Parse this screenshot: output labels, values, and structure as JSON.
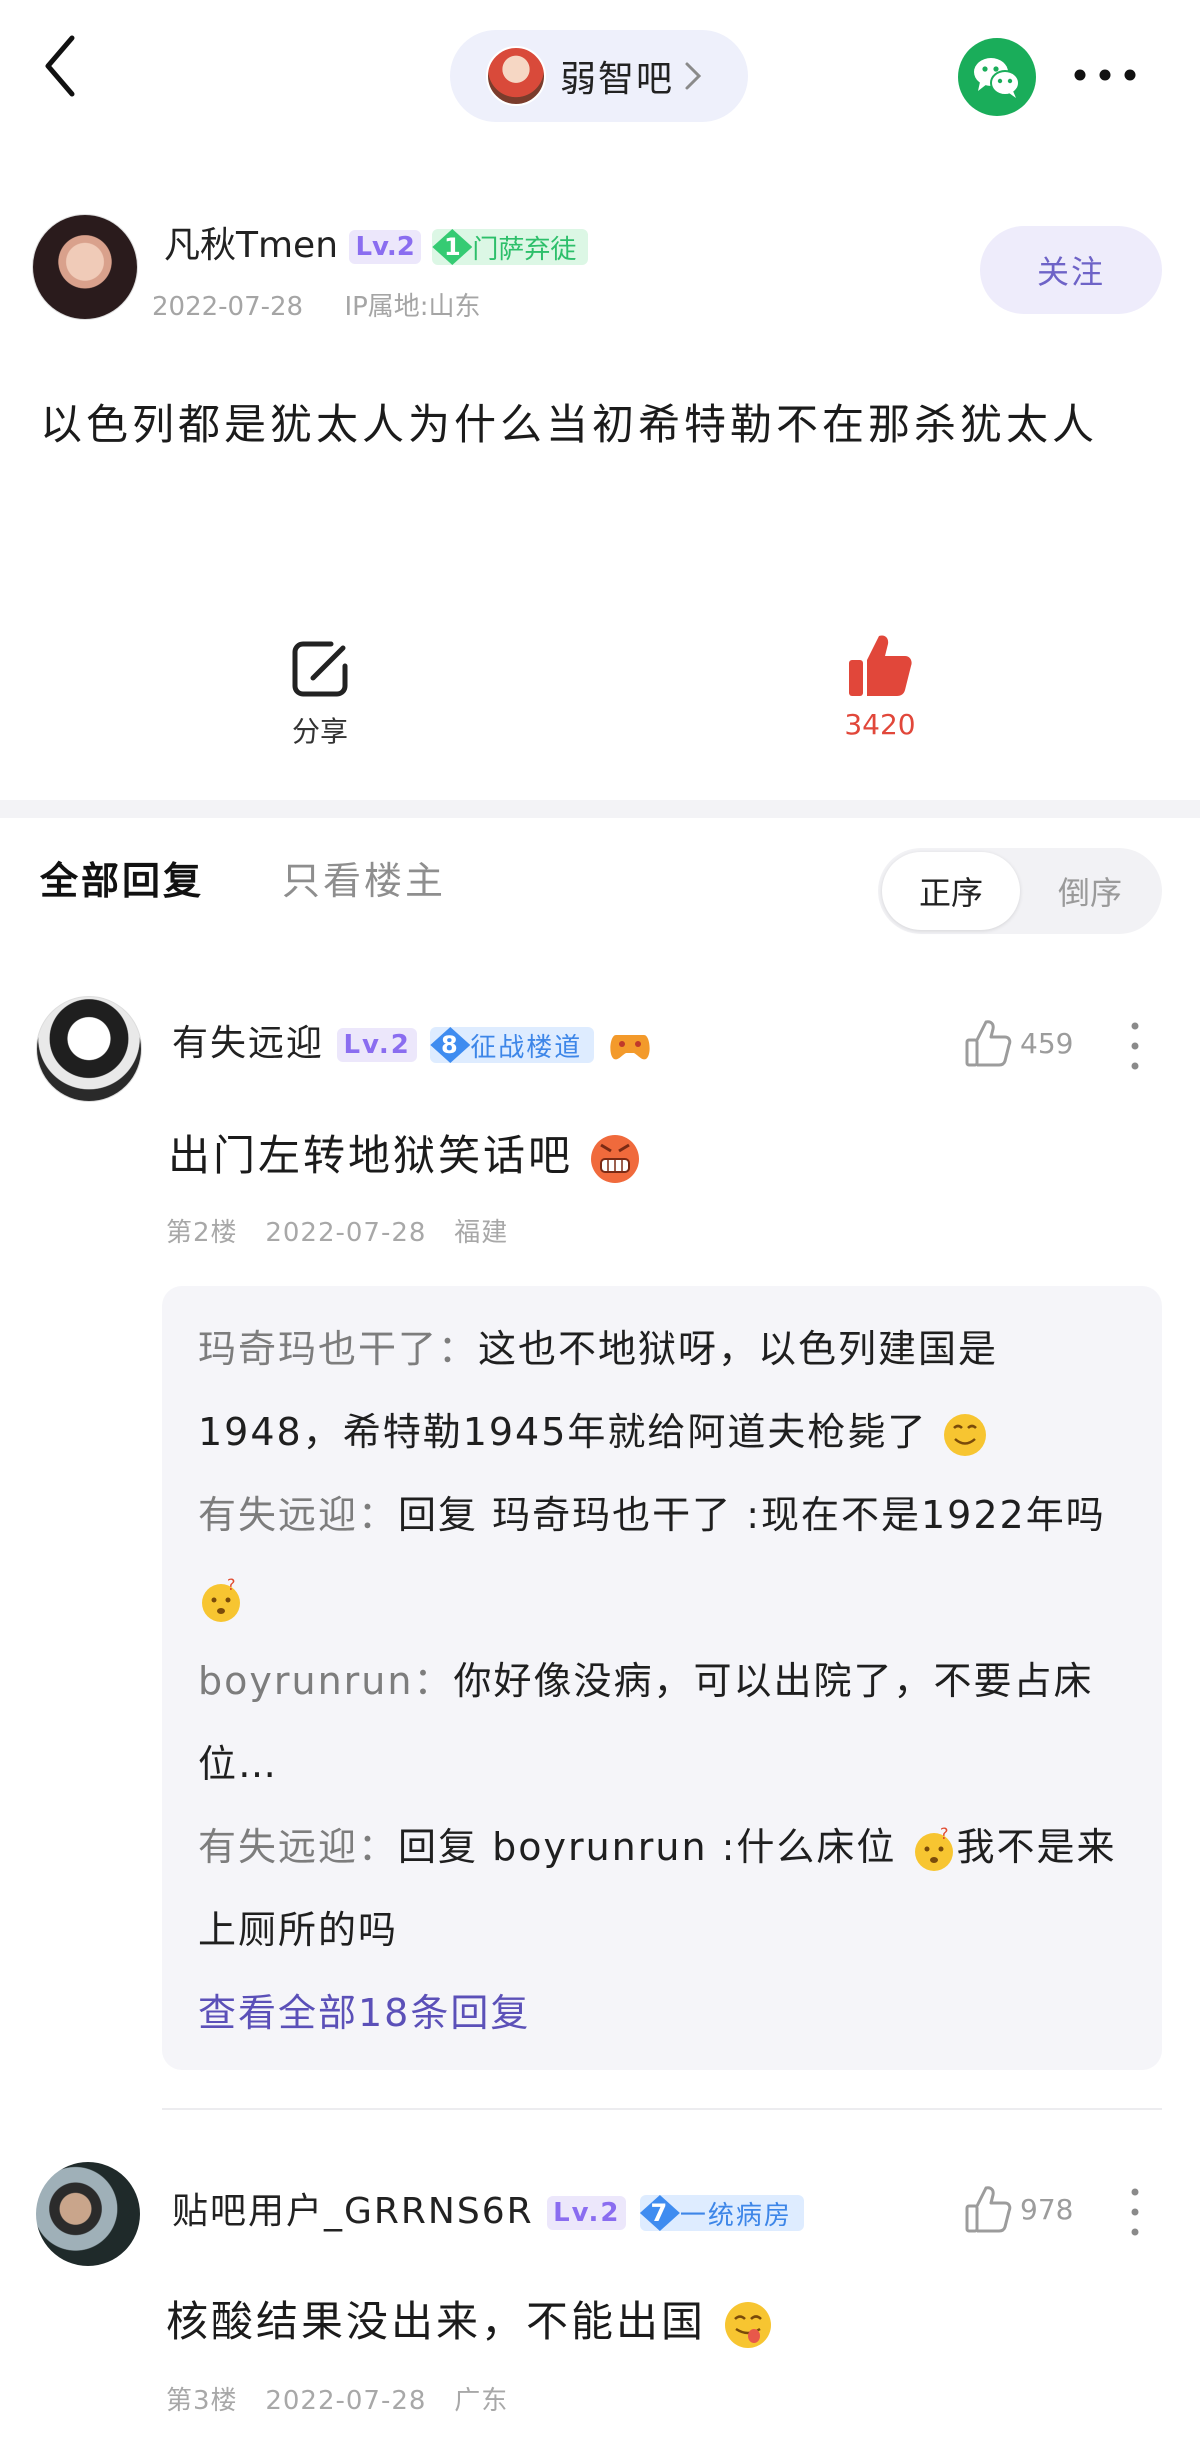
{
  "header": {
    "forum_name": "弱智吧",
    "back_icon": "back-chevron-icon",
    "share_icon": "wechat-icon",
    "more_icon": "more-dots-icon"
  },
  "post": {
    "author": {
      "name": "凡秋Tmen",
      "level": "Lv.2",
      "badge_num": "1",
      "badge_title": "门萨弃徒",
      "date": "2022-07-28",
      "ip": "IP属地:山东"
    },
    "follow_label": "关注",
    "content": "以色列都是犹太人为什么当初希特勒不在那杀犹太人",
    "share_label": "分享",
    "like_count": "3420"
  },
  "tabs": {
    "all": "全部回复",
    "owner_only": "只看楼主",
    "sort_asc": "正序",
    "sort_desc": "倒序"
  },
  "replies": [
    {
      "name": "有失远迎",
      "level": "Lv.2",
      "badge_num": "8",
      "badge_title": "征战楼道",
      "likes": "459",
      "text": "出门左转地狱笑话吧",
      "floor": "第2楼",
      "date": "2022-07-28",
      "location": "福建",
      "sub_replies": [
        {
          "author": "玛奇玛也干了",
          "text": "这也不地狱呀，以色列建国是1948，希特勒1945年就给阿道夫枪毙了"
        },
        {
          "author": "有失远迎",
          "text": "回复 玛奇玛也干了 :现在不是1922年吗"
        },
        {
          "author": "boyrunrun",
          "text": "你好像没病，可以出院了，不要占床位…"
        },
        {
          "author": "有失远迎",
          "text_a": "回复 boyrunrun :什么床位",
          "text_b": "我不是来上厕所的吗"
        }
      ],
      "view_all": "查看全部18条回复"
    },
    {
      "name": "贴吧用户_GRRNS6R",
      "level": "Lv.2",
      "badge_num": "7",
      "badge_title": "一统病房",
      "likes": "978",
      "text": "核酸结果没出来，不能出国",
      "floor": "第3楼",
      "date": "2022-07-28",
      "location": "广东"
    }
  ],
  "colors": {
    "accent": "#6e63c7",
    "like_red": "#e1473a",
    "wechat_green": "#1aad5a"
  }
}
